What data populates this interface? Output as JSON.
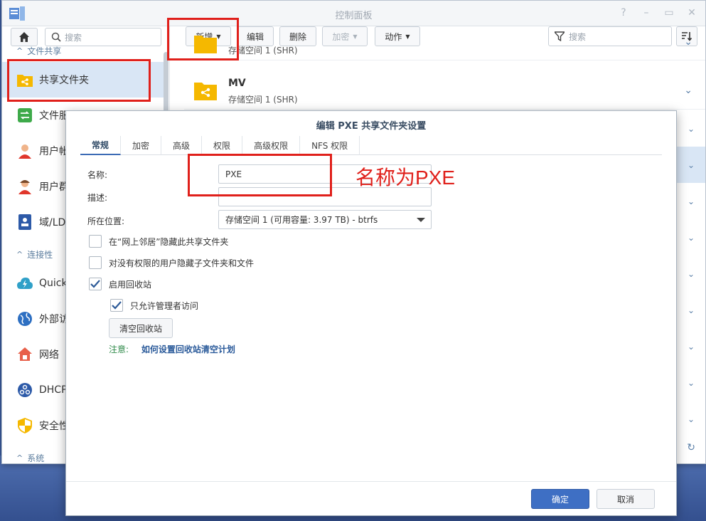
{
  "window": {
    "title": "控制面板",
    "controls": [
      "?",
      "–",
      "▭",
      "✕"
    ]
  },
  "sidebar": {
    "search_placeholder": "搜索",
    "section_file_sharing": "文件共享",
    "section_connectivity": "连接性",
    "section_system": "系统",
    "items": [
      {
        "label": "共享文件夹",
        "icon": "share-folder-icon"
      },
      {
        "label": "文件服",
        "icon": "file-service-icon"
      },
      {
        "label": "用户帐",
        "icon": "user-account-icon"
      },
      {
        "label": "用户群",
        "icon": "user-group-icon"
      },
      {
        "label": "域/LDA",
        "icon": "domain-ldap-icon"
      },
      {
        "label": "Quick",
        "icon": "quickconnect-icon"
      },
      {
        "label": "外部访",
        "icon": "external-access-icon"
      },
      {
        "label": "网络",
        "icon": "network-icon"
      },
      {
        "label": "DHCP",
        "icon": "dhcp-icon"
      },
      {
        "label": "安全性",
        "icon": "security-icon"
      }
    ]
  },
  "toolbar": {
    "create": "新增",
    "edit": "编辑",
    "delete": "删除",
    "encrypt": "加密",
    "action": "动作",
    "search_placeholder": "搜索"
  },
  "list": {
    "rows": [
      {
        "name": "",
        "sub": "存储空间 1 (SHR)"
      },
      {
        "name": "MV",
        "sub": "存储空间 1 (SHR)"
      }
    ]
  },
  "dialog": {
    "title": "编辑 PXE 共享文件夹设置",
    "tabs": [
      "常规",
      "加密",
      "高级",
      "权限",
      "高级权限",
      "NFS 权限"
    ],
    "name_label": "名称:",
    "name_value": "PXE",
    "desc_label": "描述:",
    "desc_value": "",
    "location_label": "所在位置:",
    "location_value": "存储空间 1 (可用容量:  3.97 TB) - btrfs",
    "cb_hide_network": "在“网上邻居”隐藏此共享文件夹",
    "cb_hide_subfolders": "对没有权限的用户隐藏子文件夹和文件",
    "cb_recycle_bin": "启用回收站",
    "cb_admin_only": "只允许管理者访问",
    "clear_recycle": "清空回收站",
    "note_label": "注意:",
    "note_link": "如何设置回收站清空计划",
    "ok": "确定",
    "cancel": "取消"
  },
  "annotation": "名称为PXE",
  "colors": {
    "accent": "#3e6fc4",
    "highlight_red": "#e0201b",
    "folder_yellow": "#f5b800",
    "sidebar_active": "#d9e6f5"
  }
}
